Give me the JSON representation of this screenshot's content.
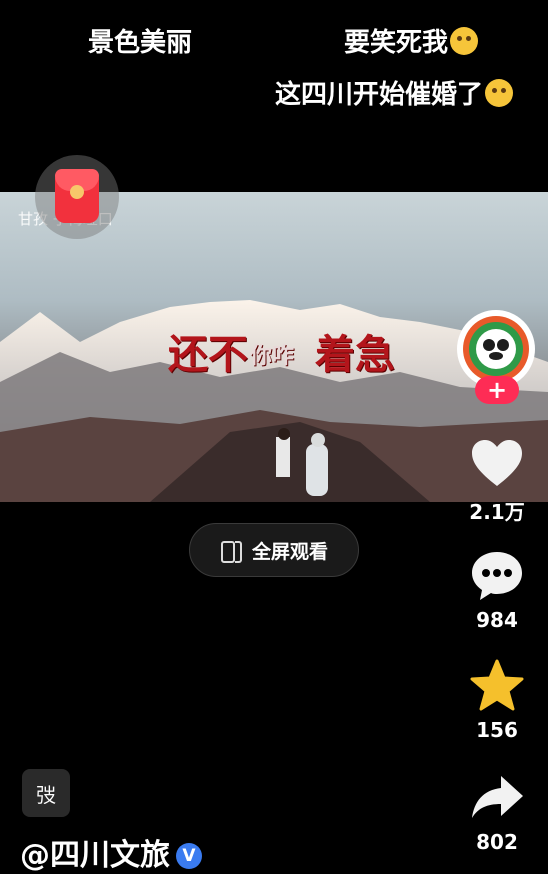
{
  "danmaku": {
    "left": "景色美丽",
    "right": "要笑死我",
    "right2": "这四川开始催婚了"
  },
  "video": {
    "watermark": "甘孜  子梅垭口",
    "overlay_1": "还不",
    "overlay_2": "你咋",
    "overlay_3": "着急"
  },
  "fullscreen_button": {
    "label": "全屏观看"
  },
  "actions": {
    "follow_label": "+",
    "like_count": "2.1万",
    "comment_count": "984",
    "favorite_count": "156",
    "share_count": "802"
  },
  "bottom": {
    "draft_glyph": "弢",
    "author": "@四川文旅",
    "verified_mark": "V"
  },
  "colors": {
    "follow": "#fe2c55",
    "verified": "#3a7bf0",
    "star": "#f5c02c"
  }
}
